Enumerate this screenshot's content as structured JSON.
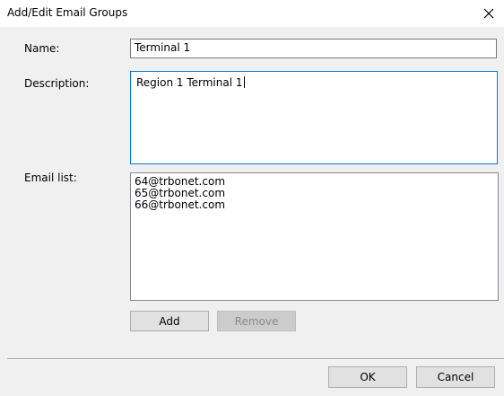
{
  "window": {
    "title": "Add/Edit Email Groups",
    "close_glyph": "✕"
  },
  "form": {
    "name_label": "Name:",
    "name_value": "Terminal 1",
    "description_label": "Description:",
    "description_value": "Region 1 Terminal 1",
    "email_list_label": "Email list:",
    "emails": [
      "64@trbonet.com",
      "65@trbonet.com",
      "66@trbonet.com"
    ]
  },
  "buttons": {
    "add": "Add",
    "remove": "Remove",
    "ok": "OK",
    "cancel": "Cancel"
  },
  "colors": {
    "client_background": "#f0f0f0",
    "focus_border": "#0078d7"
  }
}
